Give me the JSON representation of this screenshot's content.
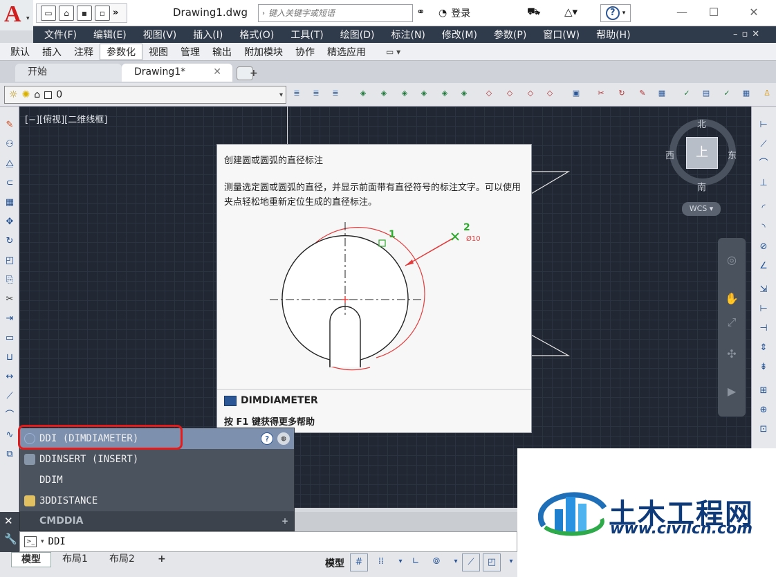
{
  "titlebar": {
    "doc_title": "Drawing1.dwg",
    "search_placeholder": "键入关键字或短语",
    "login_label": "登录",
    "more_label": "»"
  },
  "menubar": {
    "items": [
      "文件(F)",
      "编辑(E)",
      "视图(V)",
      "插入(I)",
      "格式(O)",
      "工具(T)",
      "绘图(D)",
      "标注(N)",
      "修改(M)",
      "参数(P)",
      "窗口(W)",
      "帮助(H)"
    ]
  },
  "ribbon": {
    "tabs": [
      "默认",
      "插入",
      "注释",
      "参数化",
      "视图",
      "管理",
      "输出",
      "附加模块",
      "协作",
      "精选应用"
    ],
    "active_tab": "参数化"
  },
  "file_tabs": {
    "start": "开始",
    "drawing": "Drawing1*",
    "close_glyph": "✕",
    "add_glyph": "+"
  },
  "layer": {
    "current": "0"
  },
  "viewport": {
    "label": "[−][俯视][二维线框]"
  },
  "viewcube": {
    "north": "北",
    "south": "南",
    "east": "东",
    "west": "西",
    "face": "上",
    "wcs": "WCS"
  },
  "tooltip": {
    "title": "创建圆或圆弧的直径标注",
    "description": "测量选定圆或圆弧的直径，并显示前面带有直径符号的标注文字。可以使用夹点轻松地重新定位生成的直径标注。",
    "illustration": {
      "point1": "1",
      "point2": "2",
      "dimension_text": "Ø10"
    },
    "command": "DIMDIAMETER",
    "help_hint": "按 F1 键获得更多帮助"
  },
  "autocomplete": {
    "items": [
      {
        "label": "DDI (DIMDIAMETER)",
        "selected": true
      },
      {
        "label": "DDINSERT (INSERT)",
        "selected": false
      },
      {
        "label": "DDIM",
        "selected": false
      },
      {
        "label": "3DDISTANCE",
        "selected": false
      }
    ],
    "group": "CMDDIA",
    "help_glyph": "?"
  },
  "commandline": {
    "value": "DDI"
  },
  "layout_tabs": [
    "模型",
    "布局1",
    "布局2"
  ],
  "status": {
    "model_label": "模型"
  },
  "watermark": {
    "title": "土木工程网",
    "url": "www.civilcn.com"
  },
  "colors": {
    "menubar_bg": "#2f3a4a",
    "canvas_bg": "#222833",
    "highlight_red": "#e31b1b",
    "watermark_blue": "#0f3a7a"
  }
}
